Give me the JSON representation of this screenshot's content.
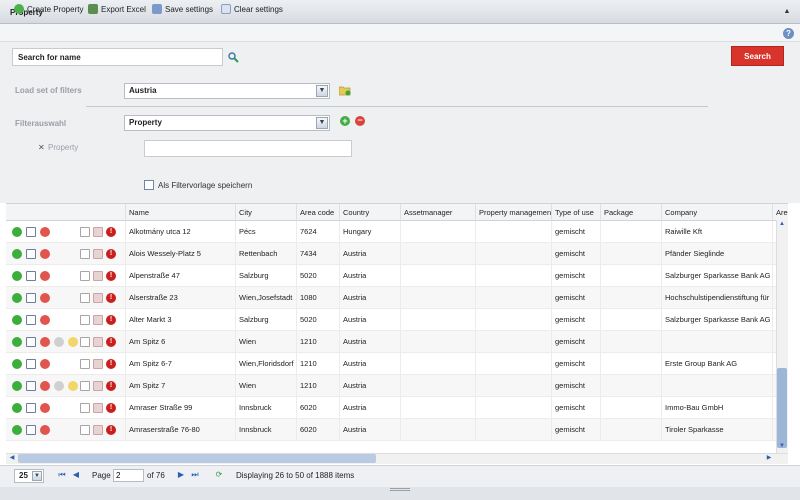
{
  "panel": {
    "title": "Property"
  },
  "toolbar": {
    "create": "Create Property",
    "export": "Export Excel",
    "save": "Save settings",
    "clear": "Clear settings"
  },
  "search": {
    "value": "Search for name",
    "button": "Search"
  },
  "filters": {
    "load_label": "Load set of filters",
    "load_value": "Austria",
    "select_label": "Filterauswahl",
    "select_value": "Property",
    "property_label": "Property",
    "property_value": "",
    "save_template": "Als Filtervorlage speichern"
  },
  "grid": {
    "columns": [
      "Name",
      "City",
      "Area code",
      "Country",
      "Assetmanager",
      "Property management",
      "Type of use",
      "Package",
      "Company",
      "Are"
    ],
    "rows": [
      {
        "name": "Alkotmány utca 12",
        "city": "Pécs",
        "code": "7624",
        "country": "Hungary",
        "use": "gemischt",
        "company": "Raiwille Kft",
        "extra": false
      },
      {
        "name": "Alois Wessely-Platz 5",
        "city": "Rettenbach",
        "code": "7434",
        "country": "Austria",
        "use": "gemischt",
        "company": "Pfänder Sieglinde",
        "extra": false
      },
      {
        "name": "Alpenstraße 47",
        "city": "Salzburg",
        "code": "5020",
        "country": "Austria",
        "use": "gemischt",
        "company": "Salzburger Sparkasse Bank AG",
        "extra": false
      },
      {
        "name": "Alserstraße 23",
        "city": "Wien,Josefstadt",
        "code": "1080",
        "country": "Austria",
        "use": "gemischt",
        "company": "Hochschulstipendienstiftung für",
        "extra": false
      },
      {
        "name": "Alter Markt 3",
        "city": "Salzburg",
        "code": "5020",
        "country": "Austria",
        "use": "gemischt",
        "company": "Salzburger Sparkasse Bank AG",
        "extra": false
      },
      {
        "name": "Am Spitz 6",
        "city": "Wien",
        "code": "1210",
        "country": "Austria",
        "use": "gemischt",
        "company": "",
        "extra": true
      },
      {
        "name": "Am Spitz 6-7",
        "city": "Wien,Floridsdorf",
        "code": "1210",
        "country": "Austria",
        "use": "gemischt",
        "company": "Erste Group Bank AG",
        "extra": false
      },
      {
        "name": "Am Spitz 7",
        "city": "Wien",
        "code": "1210",
        "country": "Austria",
        "use": "gemischt",
        "company": "",
        "extra": true
      },
      {
        "name": "Amraser Straße 99",
        "city": "Innsbruck",
        "code": "6020",
        "country": "Austria",
        "use": "gemischt",
        "company": "Immo-Bau GmbH",
        "extra": false
      },
      {
        "name": "Amraserstraße 76-80",
        "city": "Innsbruck",
        "code": "6020",
        "country": "Austria",
        "use": "gemischt",
        "company": "Tiroler Sparkasse",
        "extra": false
      }
    ]
  },
  "pager": {
    "page_size": "25",
    "page_label": "Page",
    "page_value": "2",
    "of_label": "of 76",
    "status": "Displaying 26 to 50 of 1888 items"
  }
}
